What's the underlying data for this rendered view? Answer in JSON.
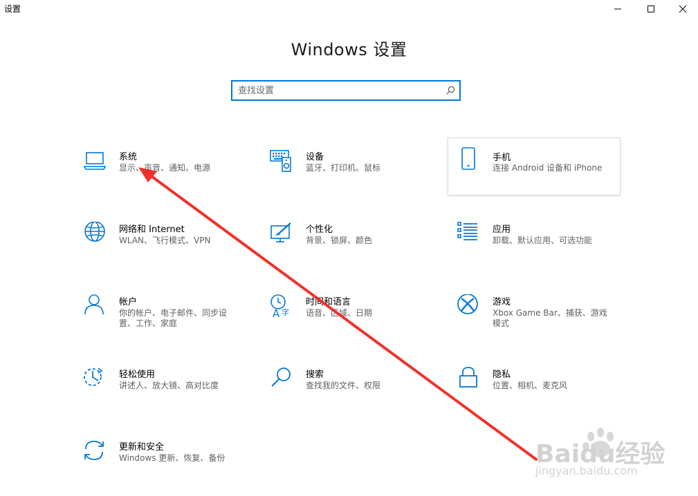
{
  "window": {
    "app_title": "设置",
    "controls": [
      "minimize",
      "maximize",
      "close"
    ]
  },
  "header": {
    "title": "Windows 设置"
  },
  "search": {
    "placeholder": "查找设置",
    "value": ""
  },
  "categories": [
    {
      "name": "系统",
      "desc": "显示、声音、通知、电源",
      "icon": "laptop-icon"
    },
    {
      "name": "设备",
      "desc": "蓝牙、打印机、鼠标",
      "icon": "keyboard-speaker-icon"
    },
    {
      "name": "手机",
      "desc": "连接 Android 设备和 iPhone",
      "icon": "phone-icon"
    },
    {
      "name": "网络和 Internet",
      "desc": "WLAN、飞行模式、VPN",
      "icon": "globe-icon"
    },
    {
      "name": "个性化",
      "desc": "背景、锁屏、颜色",
      "icon": "paintbrush-monitor-icon"
    },
    {
      "name": "应用",
      "desc": "卸载、默认应用、可选功能",
      "icon": "apps-list-icon"
    },
    {
      "name": "帐户",
      "desc": "你的帐户、电子邮件、同步设置、工作、家庭",
      "icon": "person-icon"
    },
    {
      "name": "时间和语言",
      "desc": "语音、区域、日期",
      "icon": "time-language-icon"
    },
    {
      "name": "游戏",
      "desc": "Xbox Game Bar、捕获、游戏模式",
      "icon": "xbox-icon"
    },
    {
      "name": "轻松使用",
      "desc": "讲述人、放大镜、高对比度",
      "icon": "ease-of-access-icon"
    },
    {
      "name": "搜索",
      "desc": "查找我的文件、权限",
      "icon": "magnifier-icon"
    },
    {
      "name": "隐私",
      "desc": "位置、相机、麦克风",
      "icon": "lock-icon"
    },
    {
      "name": "更新和安全",
      "desc": "Windows 更新、恢复、备份",
      "icon": "sync-arrows-icon"
    }
  ],
  "watermark": {
    "brand": "Baidu经验",
    "url": "jingyan.baidu.com"
  },
  "colors": {
    "accent": "#0078d7",
    "annotation": "#f0302a"
  }
}
